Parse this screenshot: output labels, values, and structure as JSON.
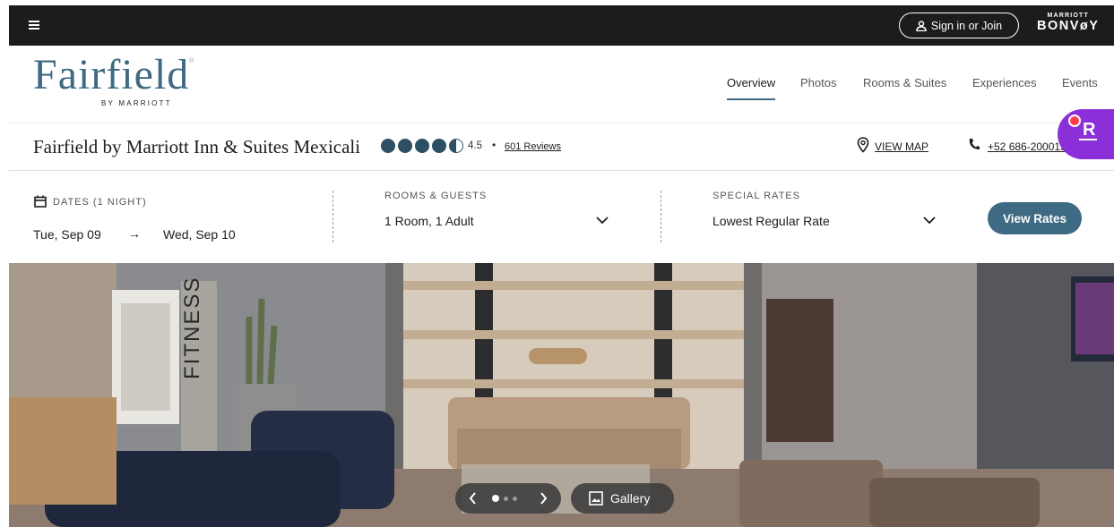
{
  "topbar": {
    "signin_label": "Sign in or Join",
    "brand_small": "MARRIOTT",
    "brand_large": "BONVøY"
  },
  "brand": {
    "logo_word": "Fairfield",
    "logo_sub": "BY MARRIOTT",
    "logo_reg": "®"
  },
  "nav": [
    "Overview",
    "Photos",
    "Rooms & Suites",
    "Experiences",
    "Events"
  ],
  "hotel": {
    "name": "Fairfield by Marriott Inn & Suites Mexicali",
    "rating": "4.5",
    "rating_value": 4.5,
    "bullet": "•",
    "reviews": "601 Reviews",
    "map_label": "VIEW MAP",
    "phone": "+52 686-2000150",
    "badge_letter": "R"
  },
  "search": {
    "dates_label": "DATES (1 NIGHT)",
    "check_in": "Tue, Sep 09",
    "arrow": "→",
    "check_out": "Wed, Sep 10",
    "rooms_label": "ROOMS & GUESTS",
    "rooms_value": "1 Room, 1 Adult",
    "rates_label": "SPECIAL RATES",
    "rates_value": "Lowest Regular Rate",
    "cta": "View Rates"
  },
  "hero": {
    "sign_text": "FITNESS",
    "gallery_label": "Gallery",
    "carousel_active": 1,
    "carousel_total": 3
  },
  "colors": {
    "topbar": "#1c1c1c",
    "brand_blue": "#3f6a83",
    "rating_dot": "#2c4f64",
    "badge_purple": "#8b2fd9"
  }
}
